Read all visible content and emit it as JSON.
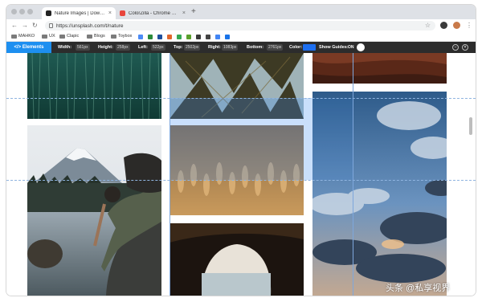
{
  "tabs": [
    {
      "label": "Nature Images | Download Fre",
      "active": true,
      "favicon_color": "#222222"
    },
    {
      "label": "ColorZilla - Chrome Web Store",
      "active": false,
      "favicon_color": "#e8453c"
    }
  ],
  "new_tab_glyph": "+",
  "address_bar": {
    "url": "https://unsplash.com/t/nature"
  },
  "bookmarks": [
    {
      "label": "MAHKO",
      "icon": "folder-icon"
    },
    {
      "label": "UX",
      "icon": "folder-icon"
    },
    {
      "label": "Clapic",
      "icon": "folder-icon"
    },
    {
      "label": "Blogs",
      "icon": "folder-icon"
    },
    {
      "label": "Toybox",
      "icon": "folder-icon"
    }
  ],
  "bookmark_icon_colors": [
    "#4c8bf5",
    "#2a8a3a",
    "#1f4f9c",
    "#e0662c",
    "#34a853",
    "#5aa02c",
    "#3a3a3a",
    "#444444",
    "#4285f4",
    "#1a73e8"
  ],
  "devbar": {
    "elements_label": "</> Elements",
    "width_label": "Width:",
    "width_value": "561px",
    "height_label": "Height:",
    "height_value": "258px",
    "left_label": "Left:",
    "left_value": "522px",
    "top_label": "Top:",
    "top_value": "2502px",
    "right_label": "Right:",
    "right_value": "1083px",
    "bottom_label": "Bottom:",
    "bottom_value": "2761px",
    "color_label": "Color:",
    "color_value": "#1d6ff0",
    "guides_label": "Show Guides:",
    "guides_state": "ON"
  },
  "colors": {
    "accent": "#1d8ff0",
    "devbar_bg": "#2c2c2c",
    "overlay": "#3c8cf0"
  },
  "photos": [
    {
      "name": "photo-grass",
      "subject": "grass"
    },
    {
      "name": "photo-forest-canopy",
      "subject": "forest canopy"
    },
    {
      "name": "photo-rock",
      "subject": "red rock"
    },
    {
      "name": "photo-mountain-lake",
      "subject": "mountain lake with hiker"
    },
    {
      "name": "photo-wheat",
      "subject": "wheat field"
    },
    {
      "name": "photo-sky-clouds",
      "subject": "cloudy sky"
    },
    {
      "name": "photo-cave",
      "subject": "cave arch"
    }
  ],
  "watermark": "头条 @私享视界"
}
